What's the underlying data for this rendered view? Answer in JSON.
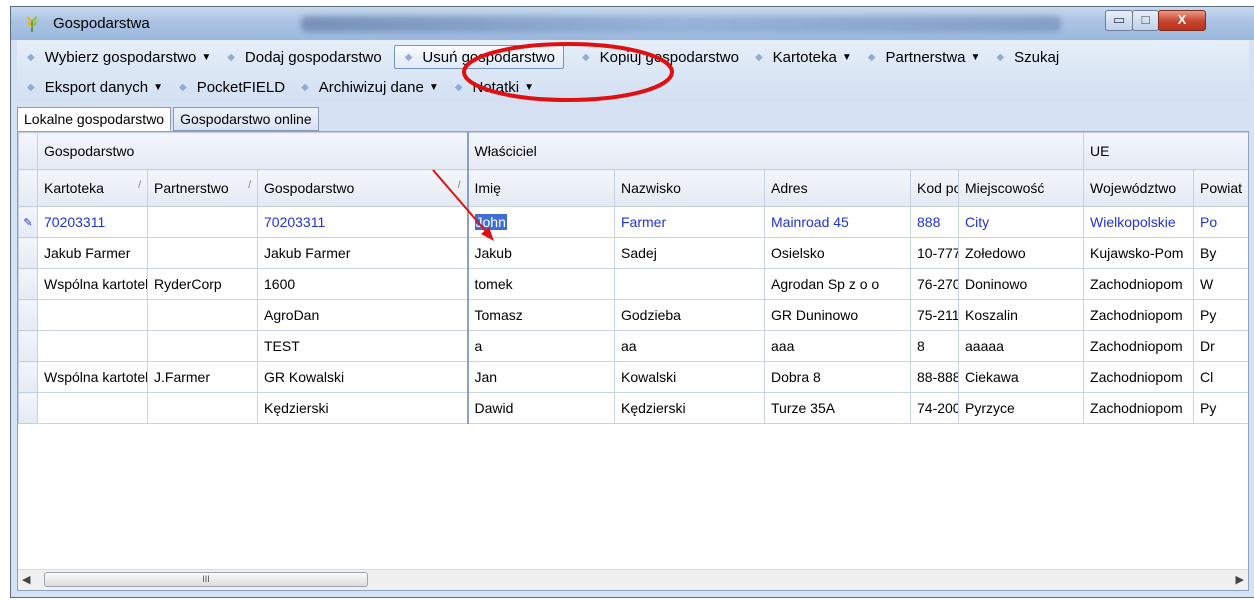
{
  "window": {
    "title": "Gospodarstwa",
    "min_glyph": "▭",
    "max_glyph": "□",
    "close_glyph": "X"
  },
  "toolbar": {
    "row1": [
      {
        "label": "Wybierz gospodarstwo",
        "dropdown": true
      },
      {
        "label": "Dodaj gospodarstwo",
        "dropdown": false
      },
      {
        "label": "Usuń gospodarstwo",
        "dropdown": false,
        "highlighted": true
      },
      {
        "label": "Kopiuj gospodarstwo",
        "dropdown": false
      },
      {
        "label": "Kartoteka",
        "dropdown": true
      },
      {
        "label": "Partnerstwa",
        "dropdown": true
      },
      {
        "label": "Szukaj",
        "dropdown": false
      }
    ],
    "row2": [
      {
        "label": "Eksport danych",
        "dropdown": true
      },
      {
        "label": "PocketFIELD",
        "dropdown": false
      },
      {
        "label": "Archiwizuj dane",
        "dropdown": true
      },
      {
        "label": "Notatki",
        "dropdown": true
      }
    ]
  },
  "tabs": [
    {
      "label": "Lokalne gospodarstwo",
      "active": true
    },
    {
      "label": "Gospodarstwo online",
      "active": false
    }
  ],
  "grid": {
    "bands": [
      {
        "label": "Gospodarstwo",
        "span": 3
      },
      {
        "label": "Właściciel",
        "span": 6
      },
      {
        "label": "UE",
        "span": 2
      }
    ],
    "columns": [
      "Kartoteka",
      "Partnerstwo",
      "Gospodarstwo",
      "Imię",
      "Nazwisko",
      "Adres",
      "Kod pocztowy",
      "Miejscowość",
      "Województwo",
      "Powiat"
    ],
    "rows": [
      {
        "selected": true,
        "cells": [
          "70203311",
          "",
          "70203311",
          "John",
          "Farmer",
          "Mainroad 45",
          "888",
          "City",
          "Wielkopolskie",
          "Po"
        ]
      },
      {
        "selected": false,
        "cells": [
          "Jakub Farmer",
          "",
          "Jakub Farmer",
          "Jakub",
          "Sadej",
          "Osielsko",
          "10-777",
          "Zołedowo",
          "Kujawsko-Pom",
          "By"
        ]
      },
      {
        "selected": false,
        "cells": [
          "Wspólna kartoteka",
          "RyderCorp",
          "1600",
          "tomek",
          "",
          "Agrodan Sp z o o",
          "76-270",
          "Doninowo",
          "Zachodniopom",
          "W"
        ]
      },
      {
        "selected": false,
        "cells": [
          "",
          "",
          "AgroDan",
          "Tomasz",
          "Godzieba",
          "GR Duninowo",
          "75-211",
          "Koszalin",
          "Zachodniopom",
          "Py"
        ]
      },
      {
        "selected": false,
        "cells": [
          "",
          "",
          "TEST",
          "a",
          "aa",
          "aaa",
          "8",
          "aaaaa",
          "Zachodniopom",
          "Dr"
        ]
      },
      {
        "selected": false,
        "cells": [
          "Wspólna kartoteka",
          "J.Farmer",
          "GR Kowalski",
          "Jan",
          "Kowalski",
          "Dobra 8",
          "88-888",
          "Ciekawa",
          "Zachodniopom",
          "Cl"
        ]
      },
      {
        "selected": false,
        "cells": [
          "",
          "",
          "Kędzierski",
          "Dawid",
          "Kędzierski",
          "Turze 35A",
          "74-200",
          "Pyrzyce",
          "Zachodniopom",
          "Py"
        ]
      }
    ],
    "edit_glyph": "✎"
  },
  "scrollbar": {
    "left_glyph": "◀",
    "right_glyph": "▶",
    "thumb_glyph": "III"
  },
  "annotation": {
    "ellipse_color": "#e01010",
    "arrow_color": "#e01010"
  },
  "colors": {
    "selected_row_text": "#1f33d6",
    "window_frame": "#aac3e3"
  }
}
